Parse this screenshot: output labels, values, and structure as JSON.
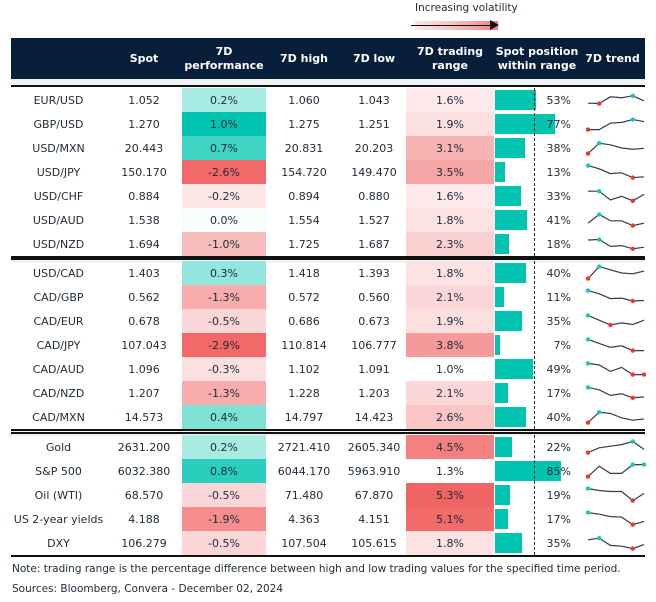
{
  "legend": {
    "label": "Increasing volatility"
  },
  "columns": {
    "name": "",
    "spot": "Spot",
    "perf": "7D\nperformance",
    "high": "7D high",
    "low": "7D low",
    "range": "7D trading\nrange",
    "position": "Spot position\nwithin range",
    "trend": "7D trend"
  },
  "colors": {
    "header_bg": "#071f3a",
    "position_bar": "#00c4b0",
    "spark_line": "#2b3e55",
    "spark_high": "#17c9b5",
    "spark_low": "#e8392f"
  },
  "groups": [
    {
      "rows": [
        {
          "name": "EUR/USD",
          "spot": "1.052",
          "perf": "0.2%",
          "perf_val": 0.2,
          "high": "1.060",
          "low": "1.043",
          "range": "1.6%",
          "range_val": 1.6,
          "pos": 53,
          "pos_label": "53%",
          "trend": [
            0.3,
            0.28,
            0.7,
            0.64,
            0.76,
            0.45
          ],
          "hi": 4,
          "lo": [
            1
          ]
        },
        {
          "name": "GBP/USD",
          "spot": "1.270",
          "perf": "1.0%",
          "perf_val": 1.0,
          "high": "1.275",
          "low": "1.251",
          "range": "1.9%",
          "range_val": 1.9,
          "pos": 77,
          "pos_label": "77%",
          "trend": [
            0.15,
            0.15,
            0.55,
            0.6,
            0.78,
            0.65
          ],
          "hi": 4,
          "lo": [
            0
          ]
        },
        {
          "name": "USD/MXN",
          "spot": "20.443",
          "perf": "0.7%",
          "perf_val": 0.7,
          "high": "20.831",
          "low": "20.203",
          "range": "3.1%",
          "range_val": 3.1,
          "pos": 38,
          "pos_label": "38%",
          "trend": [
            0.15,
            0.8,
            0.7,
            0.5,
            0.42,
            0.48
          ],
          "hi": 1,
          "lo": [
            0
          ]
        },
        {
          "name": "USD/JPY",
          "spot": "150.170",
          "perf": "-2.6%",
          "perf_val": -2.6,
          "high": "154.720",
          "low": "149.470",
          "range": "3.5%",
          "range_val": 3.5,
          "pos": 13,
          "pos_label": "13%",
          "trend": [
            0.9,
            0.7,
            0.4,
            0.45,
            0.15,
            0.2
          ],
          "hi": 0,
          "lo": [
            4
          ]
        },
        {
          "name": "USD/CHF",
          "spot": "0.884",
          "perf": "-0.2%",
          "perf_val": -0.2,
          "high": "0.894",
          "low": "0.880",
          "range": "1.6%",
          "range_val": 1.6,
          "pos": 33,
          "pos_label": "33%",
          "trend": [
            0.8,
            0.8,
            0.25,
            0.48,
            0.2,
            0.6
          ],
          "hi": 1,
          "lo": [
            4
          ]
        },
        {
          "name": "USD/AUD",
          "spot": "1.538",
          "perf": "0.0%",
          "perf_val": 0.0,
          "high": "1.554",
          "low": "1.527",
          "range": "1.8%",
          "range_val": 1.8,
          "pos": 41,
          "pos_label": "41%",
          "trend": [
            0.3,
            0.85,
            0.45,
            0.45,
            0.15,
            0.3
          ],
          "hi": 1,
          "lo": [
            4
          ]
        },
        {
          "name": "USD/NZD",
          "spot": "1.694",
          "perf": "-1.0%",
          "perf_val": -1.0,
          "high": "1.725",
          "low": "1.687",
          "range": "2.3%",
          "range_val": 2.3,
          "pos": 18,
          "pos_label": "18%",
          "trend": [
            0.75,
            0.78,
            0.35,
            0.4,
            0.2,
            0.3
          ],
          "hi": 1,
          "lo": [
            4
          ]
        }
      ]
    },
    {
      "rows": [
        {
          "name": "USD/CAD",
          "spot": "1.403",
          "perf": "0.3%",
          "perf_val": 0.3,
          "high": "1.418",
          "low": "1.393",
          "range": "1.8%",
          "range_val": 1.8,
          "pos": 40,
          "pos_label": "40%",
          "trend": [
            0.15,
            0.9,
            0.7,
            0.5,
            0.45,
            0.62
          ],
          "hi": 1,
          "lo": [
            0
          ]
        },
        {
          "name": "CAD/GBP",
          "spot": "0.562",
          "perf": "-1.3%",
          "perf_val": -1.3,
          "high": "0.572",
          "low": "0.560",
          "range": "2.1%",
          "range_val": 2.1,
          "pos": 11,
          "pos_label": "11%",
          "trend": [
            0.9,
            0.7,
            0.4,
            0.43,
            0.25,
            0.28
          ],
          "hi": 0,
          "lo": [
            4
          ]
        },
        {
          "name": "CAD/EUR",
          "spot": "0.678",
          "perf": "-0.5%",
          "perf_val": -0.5,
          "high": "0.686",
          "low": "0.673",
          "range": "1.9%",
          "range_val": 1.9,
          "pos": 35,
          "pos_label": "35%",
          "trend": [
            0.85,
            0.55,
            0.25,
            0.38,
            0.28,
            0.55
          ],
          "hi": 0,
          "lo": [
            2
          ]
        },
        {
          "name": "CAD/JPY",
          "spot": "107.043",
          "perf": "-2.9%",
          "perf_val": -2.9,
          "high": "110.814",
          "low": "106.777",
          "range": "3.8%",
          "range_val": 3.8,
          "pos": 7,
          "pos_label": "7%",
          "trend": [
            0.85,
            0.6,
            0.35,
            0.45,
            0.15,
            0.15
          ],
          "hi": 0,
          "lo": [
            4
          ]
        },
        {
          "name": "CAD/AUD",
          "spot": "1.096",
          "perf": "-0.3%",
          "perf_val": -0.3,
          "high": "1.102",
          "low": "1.091",
          "range": "1.0%",
          "range_val": 1.0,
          "pos": 49,
          "pos_label": "49%",
          "trend": [
            0.85,
            0.75,
            0.35,
            0.6,
            0.15,
            0.15
          ],
          "hi": 0,
          "lo": [
            4,
            5
          ]
        },
        {
          "name": "CAD/NZD",
          "spot": "1.207",
          "perf": "-1.3%",
          "perf_val": -1.3,
          "high": "1.228",
          "low": "1.203",
          "range": "2.1%",
          "range_val": 2.1,
          "pos": 17,
          "pos_label": "17%",
          "trend": [
            0.85,
            0.7,
            0.35,
            0.45,
            0.2,
            0.25
          ],
          "hi": 0,
          "lo": [
            4
          ]
        },
        {
          "name": "CAD/MXN",
          "spot": "14.573",
          "perf": "0.4%",
          "perf_val": 0.4,
          "high": "14.797",
          "low": "14.423",
          "range": "2.6%",
          "range_val": 2.6,
          "pos": 40,
          "pos_label": "40%",
          "trend": [
            0.15,
            0.8,
            0.72,
            0.45,
            0.3,
            0.38
          ],
          "hi": 1,
          "lo": [
            0
          ]
        }
      ]
    },
    {
      "rows": [
        {
          "name": "Gold",
          "spot": "2631.200",
          "perf": "0.2%",
          "perf_val": 0.2,
          "high": "2721.410",
          "low": "2605.340",
          "range": "4.5%",
          "range_val": 4.5,
          "pos": 22,
          "pos_label": "22%",
          "trend": [
            0.15,
            0.45,
            0.55,
            0.65,
            0.85,
            0.35
          ],
          "hi": 4,
          "lo": [
            0
          ]
        },
        {
          "name": "S&P 500",
          "spot": "6032.380",
          "perf": "0.8%",
          "perf_val": 0.8,
          "high": "6044.170",
          "low": "5963.910",
          "range": "1.3%",
          "range_val": 1.3,
          "pos": 85,
          "pos_label": "85%",
          "trend": [
            0.15,
            0.8,
            0.35,
            0.35,
            0.9,
            0.9
          ],
          "hi": 4,
          "lo": [
            0
          ],
          "hi2": 5
        },
        {
          "name": "Oil (WTI)",
          "spot": "68.570",
          "perf": "-0.5%",
          "perf_val": -0.5,
          "high": "71.480",
          "low": "67.870",
          "range": "5.3%",
          "range_val": 5.3,
          "pos": 19,
          "pos_label": "19%",
          "trend": [
            0.9,
            0.78,
            0.72,
            0.72,
            0.15,
            0.6
          ],
          "hi": 0,
          "lo": [
            4
          ]
        },
        {
          "name": "US 2-year yields",
          "spot": "4.188",
          "perf": "-1.9%",
          "perf_val": -1.9,
          "high": "4.363",
          "low": "4.151",
          "range": "5.1%",
          "range_val": 5.1,
          "pos": 17,
          "pos_label": "17%",
          "trend": [
            0.9,
            0.8,
            0.65,
            0.62,
            0.15,
            0.35
          ],
          "hi": 0,
          "lo": [
            4
          ]
        },
        {
          "name": "DXY",
          "spot": "106.279",
          "perf": "-0.5%",
          "perf_val": -0.5,
          "high": "107.504",
          "low": "105.615",
          "range": "1.8%",
          "range_val": 1.8,
          "pos": 35,
          "pos_label": "35%",
          "trend": [
            0.7,
            0.8,
            0.35,
            0.3,
            0.15,
            0.4
          ],
          "hi": 1,
          "lo": [
            4
          ]
        }
      ]
    }
  ],
  "footer": {
    "note": "Note: trading range is the percentage difference between high and low trading values for the specified time period.",
    "sources": "Sources: Bloomberg, Convera - December 02, 2024"
  }
}
